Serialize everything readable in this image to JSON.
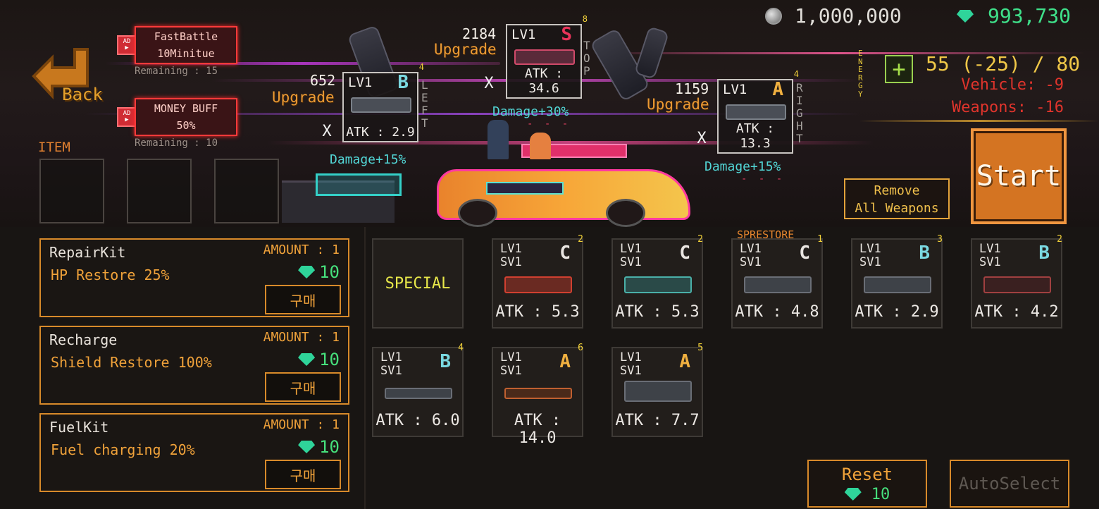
{
  "currency": {
    "coins": "1,000,000",
    "gems": "993,730"
  },
  "back": {
    "label": "Back"
  },
  "buffs": [
    {
      "ad_tag": "AD",
      "title": "FastBattle",
      "subtitle": "10Minitue",
      "remaining": "Remaining : 15"
    },
    {
      "ad_tag": "AD",
      "title": "MONEY BUFF",
      "subtitle": "50%",
      "remaining": "Remaining : 10"
    }
  ],
  "item_section": {
    "label": "ITEM"
  },
  "mounts": {
    "left": {
      "side_label": [
        "L",
        "E",
        "F",
        "T"
      ],
      "price": "652",
      "upgrade": "Upgrade",
      "level": "LV1",
      "grade": "B",
      "count": "4",
      "atk": "ATK : 2.9",
      "damage": "Damage+15%",
      "remove": "X"
    },
    "top": {
      "side_label": [
        "T",
        "O",
        "P"
      ],
      "price": "2184",
      "upgrade": "Upgrade",
      "level": "LV1",
      "grade": "S",
      "count": "8",
      "atk": "ATK : 34.6",
      "damage": "Damage+30%",
      "dashes": "- - -",
      "remove": "X"
    },
    "right": {
      "side_label": [
        "R",
        "I",
        "G",
        "H",
        "T"
      ],
      "price": "1159",
      "upgrade": "Upgrade",
      "level": "LV1",
      "grade": "A",
      "count": "4",
      "atk": "ATK : 13.3",
      "damage": "Damage+15%",
      "dashes": "- - -",
      "remove": "X"
    }
  },
  "energy": {
    "vertical_label": [
      "E",
      "N",
      "E",
      "R",
      "G",
      "Y"
    ],
    "add_button": "+",
    "value": "55 (-25) / 80",
    "vehicle": "Vehicle: -9",
    "weapons": "Weapons: -16"
  },
  "buttons": {
    "start": "Start",
    "remove_all_line1": "Remove",
    "remove_all_line2": "All Weapons",
    "reset": "Reset",
    "reset_price": "10",
    "auto_select": "AutoSelect"
  },
  "items": [
    {
      "name": "RepairKit",
      "amount": "AMOUNT : 1",
      "desc": "HP Restore 25%",
      "price": "10",
      "buy": "구매"
    },
    {
      "name": "Recharge",
      "amount": "AMOUNT : 1",
      "desc": "Shield Restore 100%",
      "price": "10",
      "buy": "구매"
    },
    {
      "name": "FuelKit",
      "amount": "AMOUNT : 1",
      "desc": "Fuel charging 20%",
      "price": "10",
      "buy": "구매"
    }
  ],
  "inventory": {
    "special_label": "SPECIAL",
    "sprestore_label": "SPRESTORE",
    "weapons": [
      {
        "lv": "LV1",
        "sv": "SV1",
        "grade": "C",
        "count": "2",
        "atk": "ATK : 5.3"
      },
      {
        "lv": "LV1",
        "sv": "SV1",
        "grade": "C",
        "count": "2",
        "atk": "ATK : 5.3"
      },
      {
        "lv": "LV1",
        "sv": "SV1",
        "grade": "C",
        "count": "1",
        "atk": "ATK : 4.8"
      },
      {
        "lv": "LV1",
        "sv": "SV1",
        "grade": "B",
        "count": "3",
        "atk": "ATK : 2.9"
      },
      {
        "lv": "LV1",
        "sv": "SV1",
        "grade": "B",
        "count": "2",
        "atk": "ATK : 4.2"
      },
      {
        "lv": "LV1",
        "sv": "SV1",
        "grade": "B",
        "count": "4",
        "atk": "ATK : 6.0"
      },
      {
        "lv": "LV1",
        "sv": "SV1",
        "grade": "A",
        "count": "6",
        "atk": "ATK : 14.0"
      },
      {
        "lv": "LV1",
        "sv": "SV1",
        "grade": "A",
        "count": "5",
        "atk": "ATK : 7.7"
      }
    ]
  },
  "colors": {
    "grade_S": "#e8345a",
    "grade_A": "#f0b040",
    "grade_B": "#7ad8e0",
    "grade_C": "#e8e4e0",
    "accent_orange": "#d88a2a",
    "gem_green": "#46e07c"
  }
}
